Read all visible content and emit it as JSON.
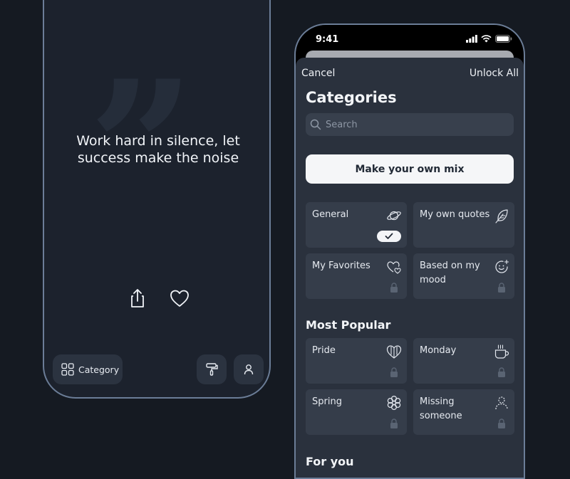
{
  "left_phone": {
    "quote": "Work hard in silence, let success make the noise",
    "quote_mark": "”",
    "category_label": "Category"
  },
  "right_phone": {
    "status_time": "9:41",
    "nav": {
      "cancel": "Cancel",
      "unlock_all": "Unlock All"
    },
    "title": "Categories",
    "search_placeholder": "Search",
    "mix_button": "Make your own mix",
    "cards_top": [
      {
        "label": "General",
        "icon": "planet-icon",
        "state": "selected"
      },
      {
        "label": "My own quotes",
        "icon": "feather-icon",
        "state": "none"
      },
      {
        "label": "My Favorites",
        "icon": "hearts-icon",
        "state": "locked"
      },
      {
        "label": "Based on my mood",
        "icon": "mood-icon",
        "state": "locked"
      }
    ],
    "section_popular": "Most Popular",
    "cards_popular": [
      {
        "label": "Pride",
        "icon": "pride-heart-icon",
        "state": "locked"
      },
      {
        "label": "Monday",
        "icon": "coffee-cup-icon",
        "state": "locked"
      },
      {
        "label": "Spring",
        "icon": "flower-icon",
        "state": "locked"
      },
      {
        "label": "Missing someone",
        "icon": "person-outline-icon",
        "state": "locked"
      }
    ],
    "section_for_you": "For you"
  },
  "colors": {
    "background": "#151a22",
    "phone_frame": "#6b7d97",
    "sheet": "#2a313d",
    "card": "#353d4a",
    "button_light": "#f5f6f8"
  }
}
